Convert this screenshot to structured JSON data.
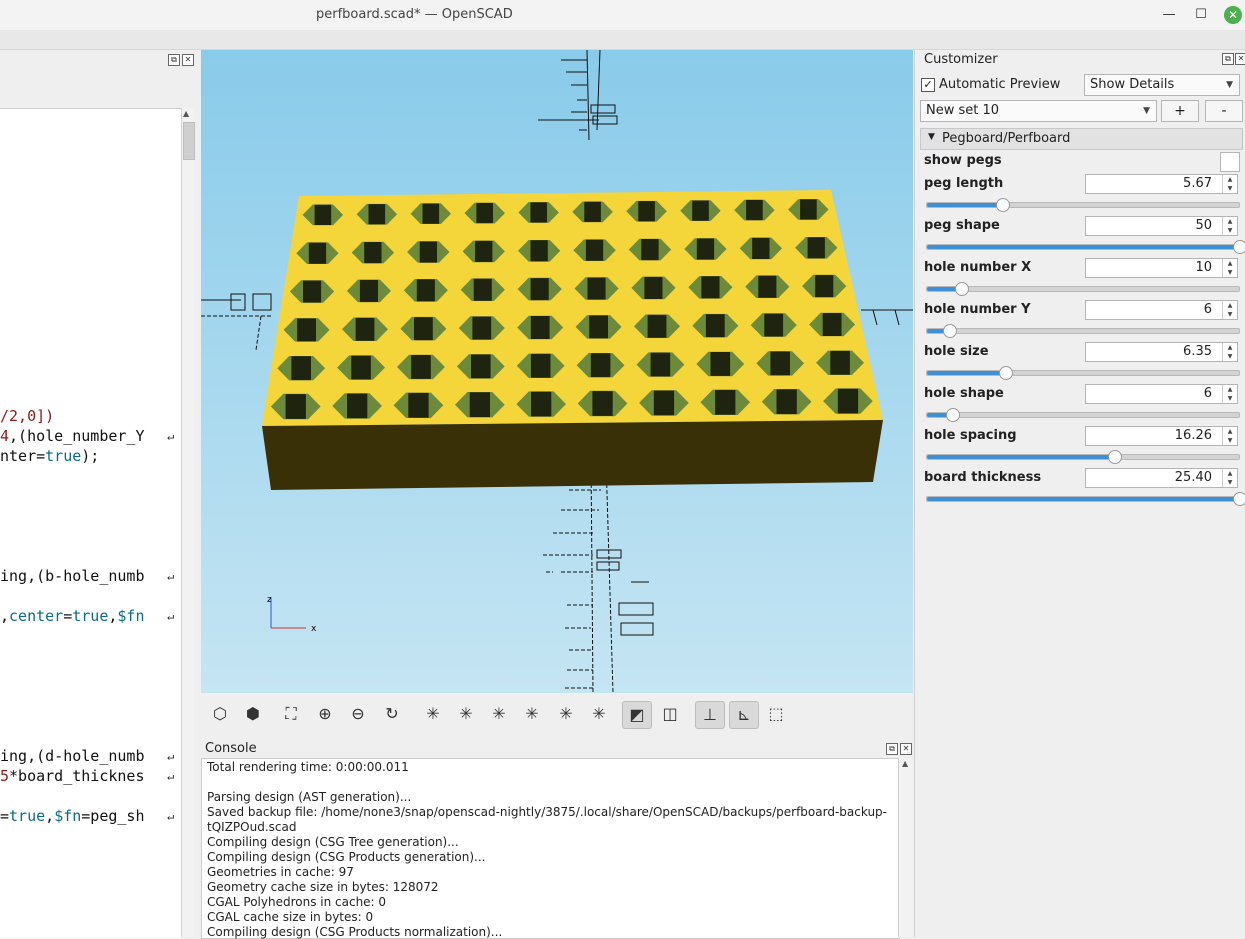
{
  "window": {
    "title": "perfboard.scad* — OpenSCAD"
  },
  "editor": {
    "lines": [
      {
        "parts": [
          {
            "t": "/2,0])",
            "c": "num"
          }
        ]
      },
      {
        "parts": [
          {
            "t": "4",
            "c": "num"
          },
          {
            "t": ",(hole_number_Y",
            "c": ""
          }
        ]
      },
      {
        "parts": [
          {
            "t": "nter",
            "c": ""
          },
          {
            "t": "=",
            "c": ""
          },
          {
            "t": "true",
            "c": "kw"
          },
          {
            "t": ");",
            "c": ""
          }
        ]
      },
      {
        "parts": [
          {
            "t": "ing,(b-hole_numb",
            "c": ""
          }
        ]
      },
      {
        "parts": [
          {
            "t": ",",
            "c": ""
          },
          {
            "t": "center",
            "c": "kw"
          },
          {
            "t": "=",
            "c": ""
          },
          {
            "t": "true",
            "c": "kw"
          },
          {
            "t": ",",
            "c": ""
          },
          {
            "t": "$fn",
            "c": "kw"
          }
        ]
      },
      {
        "parts": [
          {
            "t": "ing,(d-hole_numb",
            "c": ""
          }
        ]
      },
      {
        "parts": [
          {
            "t": "5",
            "c": "num"
          },
          {
            "t": "*board_thicknes",
            "c": ""
          }
        ]
      },
      {
        "parts": [
          {
            "t": "=",
            "c": ""
          },
          {
            "t": "true",
            "c": "kw"
          },
          {
            "t": ",",
            "c": ""
          },
          {
            "t": "$fn",
            "c": "kw"
          },
          {
            "t": "=peg_sh",
            "c": ""
          }
        ]
      }
    ]
  },
  "viewport": {
    "axis_z": "z",
    "axis_x": "x"
  },
  "console": {
    "title": "Console",
    "lines": [
      "Total rendering time: 0:00:00.011",
      "",
      "Parsing design (AST generation)...",
      "Saved backup file: /home/none3/snap/openscad-nightly/3875/.local/share/OpenSCAD/backups/perfboard-backup-",
      "tQIZPOud.scad",
      "Compiling design (CSG Tree generation)...",
      "Compiling design (CSG Products generation)...",
      "Geometries in cache: 97",
      "Geometry cache size in bytes: 128072",
      "CGAL Polyhedrons in cache: 0",
      "CGAL cache size in bytes: 0",
      "Compiling design (CSG Products normalization)..."
    ]
  },
  "customizer": {
    "title": "Customizer",
    "auto_preview_label": "Automatic Preview",
    "auto_preview_checked": true,
    "details_select": "Show Details",
    "preset_select": "New set 10",
    "add_label": "+",
    "remove_label": "-",
    "group": "Pegboard/Perfboard",
    "show_pegs_label": "show pegs",
    "params": [
      {
        "label": "peg length",
        "value": "5.67",
        "pos": 0.24
      },
      {
        "label": "peg shape",
        "value": "50",
        "pos": 1.0
      },
      {
        "label": "hole number X",
        "value": "10",
        "pos": 0.11
      },
      {
        "label": "hole number Y",
        "value": "6",
        "pos": 0.07
      },
      {
        "label": "hole size",
        "value": "6.35",
        "pos": 0.25
      },
      {
        "label": "hole shape",
        "value": "6",
        "pos": 0.08
      },
      {
        "label": "hole spacing",
        "value": "16.26",
        "pos": 0.6
      },
      {
        "label": "board thickness",
        "value": "25.40",
        "pos": 1.0
      }
    ]
  },
  "colors": {
    "board_top": "#f5d63a",
    "board_side": "#3a3008",
    "hole_ring": "#6d8a3a",
    "hole_dark": "#1f2410",
    "slider_fill": "#3d8fd8"
  }
}
